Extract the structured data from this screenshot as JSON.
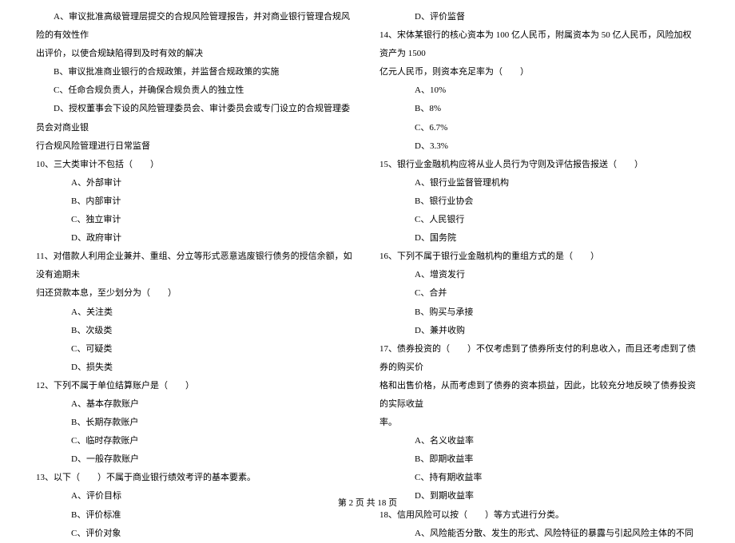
{
  "left_column": {
    "intro_lines": [
      "A、审议批准高级管理层提交的合规风险管理报告，并对商业银行管理合规风险的有效性作",
      "出评价，以使合规缺陷得到及时有效的解决"
    ],
    "intro_options": [
      "B、审议批准商业银行的合规政策，并监督合规政策的实施",
      "C、任命合规负责人，并确保合规负责人的独立性",
      "D、授权董事会下设的风险管理委员会、审计委员会或专门设立的合规管理委员会对商业银"
    ],
    "intro_continuation": "行合规风险管理进行日常监督",
    "q10": {
      "text": "10、三大类审计不包括（　　）",
      "options": [
        "A、外部审计",
        "B、内部审计",
        "C、独立审计",
        "D、政府审计"
      ]
    },
    "q11": {
      "text": "11、对借款人利用企业兼并、重组、分立等形式恶意逃废银行债务的授信余额，如没有逾期未",
      "continuation": "归还贷款本息，至少划分为（　　）",
      "options": [
        "A、关注类",
        "B、次级类",
        "C、可疑类",
        "D、损失类"
      ]
    },
    "q12": {
      "text": "12、下列不属于单位结算账户是（　　）",
      "options": [
        "A、基本存款账户",
        "B、长期存款账户",
        "C、临时存款账户",
        "D、一般存款账户"
      ]
    },
    "q13": {
      "text": "13、以下（　　）不属于商业银行绩效考评的基本要素。",
      "options": [
        "A、评价目标",
        "B、评价标准",
        "C、评价对象"
      ]
    }
  },
  "right_column": {
    "q13_continued": [
      "D、评价监督"
    ],
    "q14": {
      "text": "14、宋体某银行的核心资本为 100 亿人民币，附属资本为 50 亿人民币，风险加权资产为 1500",
      "continuation": "亿元人民币，则资本充足率为（　　）",
      "options": [
        "A、10%",
        "B、8%",
        "C、6.7%",
        "D、3.3%"
      ]
    },
    "q15": {
      "text": "15、银行业金融机构应将从业人员行为守则及评估报告报送（　　）",
      "options": [
        "A、银行业监督管理机构",
        "B、银行业协会",
        "C、人民银行",
        "D、国务院"
      ]
    },
    "q16": {
      "text": "16、下列不属于银行业金融机构的重组方式的是（　　）",
      "options": [
        "A、增资发行",
        "C、合并",
        "B、购买与承接",
        "D、兼并收购"
      ]
    },
    "q17": {
      "text": "17、债券投资的（　　）不仅考虑到了债券所支付的利息收入，而且还考虑到了债券的购买价",
      "continuation1": "格和出售价格，从而考虑到了债券的资本损益，因此，比较充分地反映了债券投资的实际收益",
      "continuation2": "率。",
      "options": [
        "A、名义收益率",
        "B、即期收益率",
        "C、持有期收益率",
        "D、到期收益率"
      ]
    },
    "q18": {
      "text": "18、信用风险可以按（　　）等方式进行分类。",
      "options": [
        "A、风险能否分散、发生的形式、风险特征的暴露与引起风险主体的不同"
      ]
    }
  },
  "footer": {
    "text": "第 2 页 共 18 页"
  }
}
